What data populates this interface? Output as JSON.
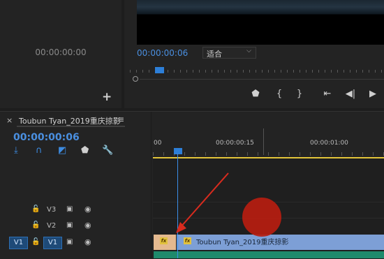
{
  "source_monitor": {
    "timecode": "00:00:00:00",
    "add_label": "+"
  },
  "program_monitor": {
    "timecode": "00:00:00:06",
    "fit_select": {
      "value": "适合",
      "caret": "⌵"
    },
    "controls": [
      {
        "name": "marker-icon",
        "glyph": "⬟"
      },
      {
        "name": "mark-in-icon",
        "glyph": "{"
      },
      {
        "name": "mark-out-icon",
        "glyph": "}"
      },
      {
        "name": "go-to-in-icon",
        "glyph": "⇤"
      },
      {
        "name": "step-back-icon",
        "glyph": "◀|"
      },
      {
        "name": "play-icon",
        "glyph": "▶"
      }
    ]
  },
  "timeline": {
    "close_glyph": "×",
    "title": "Toubun Tyan_2019重庆掠影",
    "menu_glyph": "≡",
    "timecode": "00:00:00:06",
    "ruler_labels": [
      "00",
      "00:00:00:15",
      "00:00:01:00"
    ],
    "tools": [
      {
        "name": "insert-edit-icon",
        "glyph": "⤓"
      },
      {
        "name": "snap-magnet-icon",
        "glyph": "∩"
      },
      {
        "name": "linked-selection-icon",
        "glyph": "◩"
      },
      {
        "name": "add-marker-icon",
        "glyph": "⬟"
      },
      {
        "name": "wrench-icon",
        "glyph": "🔧"
      }
    ],
    "tracks": [
      {
        "name": "V3",
        "lock": "🔓",
        "film": "▣",
        "eye": "◉"
      },
      {
        "name": "V2",
        "lock": "🔓",
        "film": "▣",
        "eye": "◉"
      },
      {
        "name": "V1",
        "source_patch": "V1",
        "lock": "🔓",
        "film": "▣",
        "eye": "◉"
      }
    ],
    "clip": {
      "fx": "fx",
      "name": "Toubun Tyan_2019重庆掠影"
    }
  },
  "colors": {
    "accent_blue": "#4a8fe0",
    "work_area": "#e3c53a",
    "clip_video": "#7d9fd6",
    "annotation_red": "#d92b1e"
  }
}
